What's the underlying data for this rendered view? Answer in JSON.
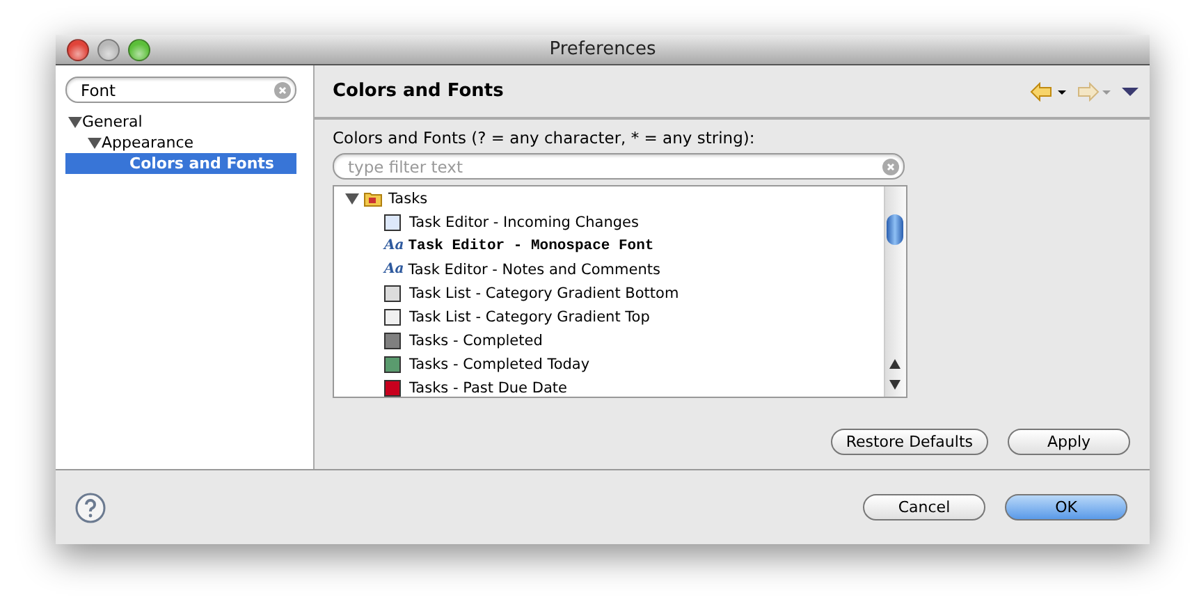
{
  "window": {
    "title": "Preferences"
  },
  "sidebar": {
    "search": {
      "value": "Font"
    },
    "tree": [
      {
        "label": "General",
        "expanded": true,
        "selected": false,
        "children": [
          {
            "label": "Appearance",
            "expanded": true,
            "selected": false,
            "children": [
              {
                "label": "Colors and Fonts",
                "selected": true
              }
            ]
          }
        ]
      }
    ]
  },
  "page": {
    "title": "Colors and Fonts",
    "filter_label": "Colors and Fonts (? = any character, * = any string):",
    "filter": {
      "placeholder": "type filter text"
    },
    "tree": {
      "label": "Tasks",
      "expanded": true,
      "children": [
        {
          "kind": "color",
          "label": "Task Editor - Incoming Changes",
          "color": "#dde8fa"
        },
        {
          "kind": "font",
          "icon": "Aa",
          "label": "Task Editor - Monospace Font",
          "monospace": true
        },
        {
          "kind": "font",
          "icon": "Aa",
          "label": "Task Editor - Notes and Comments",
          "monospace": false
        },
        {
          "kind": "color",
          "label": "Task List - Category Gradient Bottom",
          "color": "#dcdcdc"
        },
        {
          "kind": "color",
          "label": "Task List - Category Gradient Top",
          "color": "#f0f0f0"
        },
        {
          "kind": "color",
          "label": "Tasks - Completed",
          "color": "#808080"
        },
        {
          "kind": "color",
          "label": "Tasks - Completed Today",
          "color": "#5a9b6e"
        },
        {
          "kind": "color",
          "label": "Tasks - Past Due Date",
          "color": "#c8001e"
        }
      ]
    },
    "buttons": [
      "Restore Defaults",
      "Apply"
    ]
  },
  "footer": {
    "buttons": [
      {
        "label": "Cancel",
        "default": false
      },
      {
        "label": "OK",
        "default": true
      }
    ]
  }
}
